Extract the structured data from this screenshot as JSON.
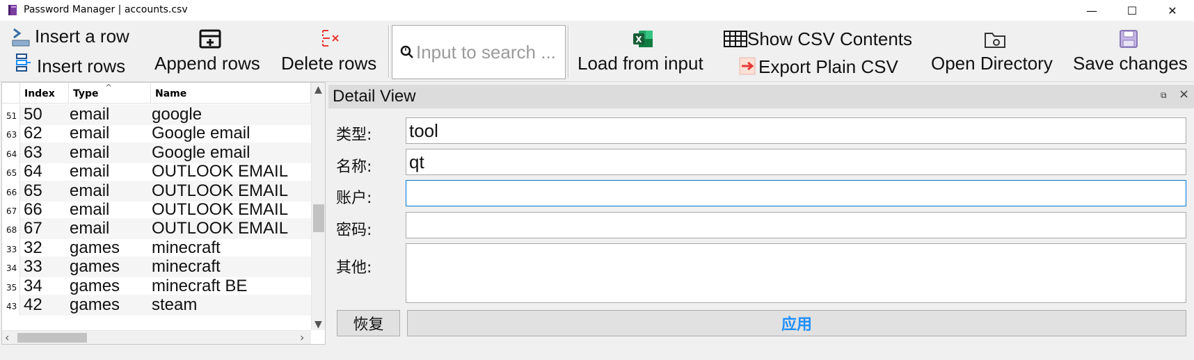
{
  "window": {
    "title": "Password Manager | accounts.csv",
    "minimize": "—",
    "maximize": "☐",
    "close": "✕"
  },
  "toolbar": {
    "insert_row": "Insert a row",
    "insert_rows": "Insert rows",
    "append_rows": "Append rows",
    "delete_rows": "Delete rows",
    "search_placeholder": "Input to search ...",
    "load_from_input": "Load from input",
    "show_csv": "Show CSV Contents",
    "export_csv": "Export Plain CSV",
    "open_directory": "Open Directory",
    "save_changes": "Save changes"
  },
  "table": {
    "columns": [
      "Index",
      "Type",
      "Name"
    ],
    "rows": [
      {
        "num": "51",
        "index": "50",
        "type": "email",
        "name": "google"
      },
      {
        "num": "63",
        "index": "62",
        "type": "email",
        "name": "Google email"
      },
      {
        "num": "64",
        "index": "63",
        "type": "email",
        "name": "Google email"
      },
      {
        "num": "65",
        "index": "64",
        "type": "email",
        "name": "OUTLOOK EMAIL"
      },
      {
        "num": "66",
        "index": "65",
        "type": "email",
        "name": "OUTLOOK EMAIL"
      },
      {
        "num": "67",
        "index": "66",
        "type": "email",
        "name": "OUTLOOK EMAIL"
      },
      {
        "num": "68",
        "index": "67",
        "type": "email",
        "name": "OUTLOOK EMAIL"
      },
      {
        "num": "33",
        "index": "32",
        "type": "games",
        "name": "minecraft"
      },
      {
        "num": "34",
        "index": "33",
        "type": "games",
        "name": "minecraft"
      },
      {
        "num": "35",
        "index": "34",
        "type": "games",
        "name": "minecraft BE"
      },
      {
        "num": "43",
        "index": "42",
        "type": "games",
        "name": "steam"
      }
    ]
  },
  "detail": {
    "title": "Detail View",
    "type_label": "类型:",
    "type_value": "tool",
    "name_label": "名称:",
    "name_value": "qt",
    "account_label": "账户:",
    "account_value": "",
    "password_label": "密码:",
    "password_value": "",
    "other_label": "其他:",
    "other_value": "",
    "restore_button": "恢复",
    "apply_button": "应用"
  },
  "colors": {
    "accent": "#0078d7",
    "apply_text": "#1e90ff",
    "excel_green": "#1d6f42",
    "delete_red": "#e53935"
  }
}
